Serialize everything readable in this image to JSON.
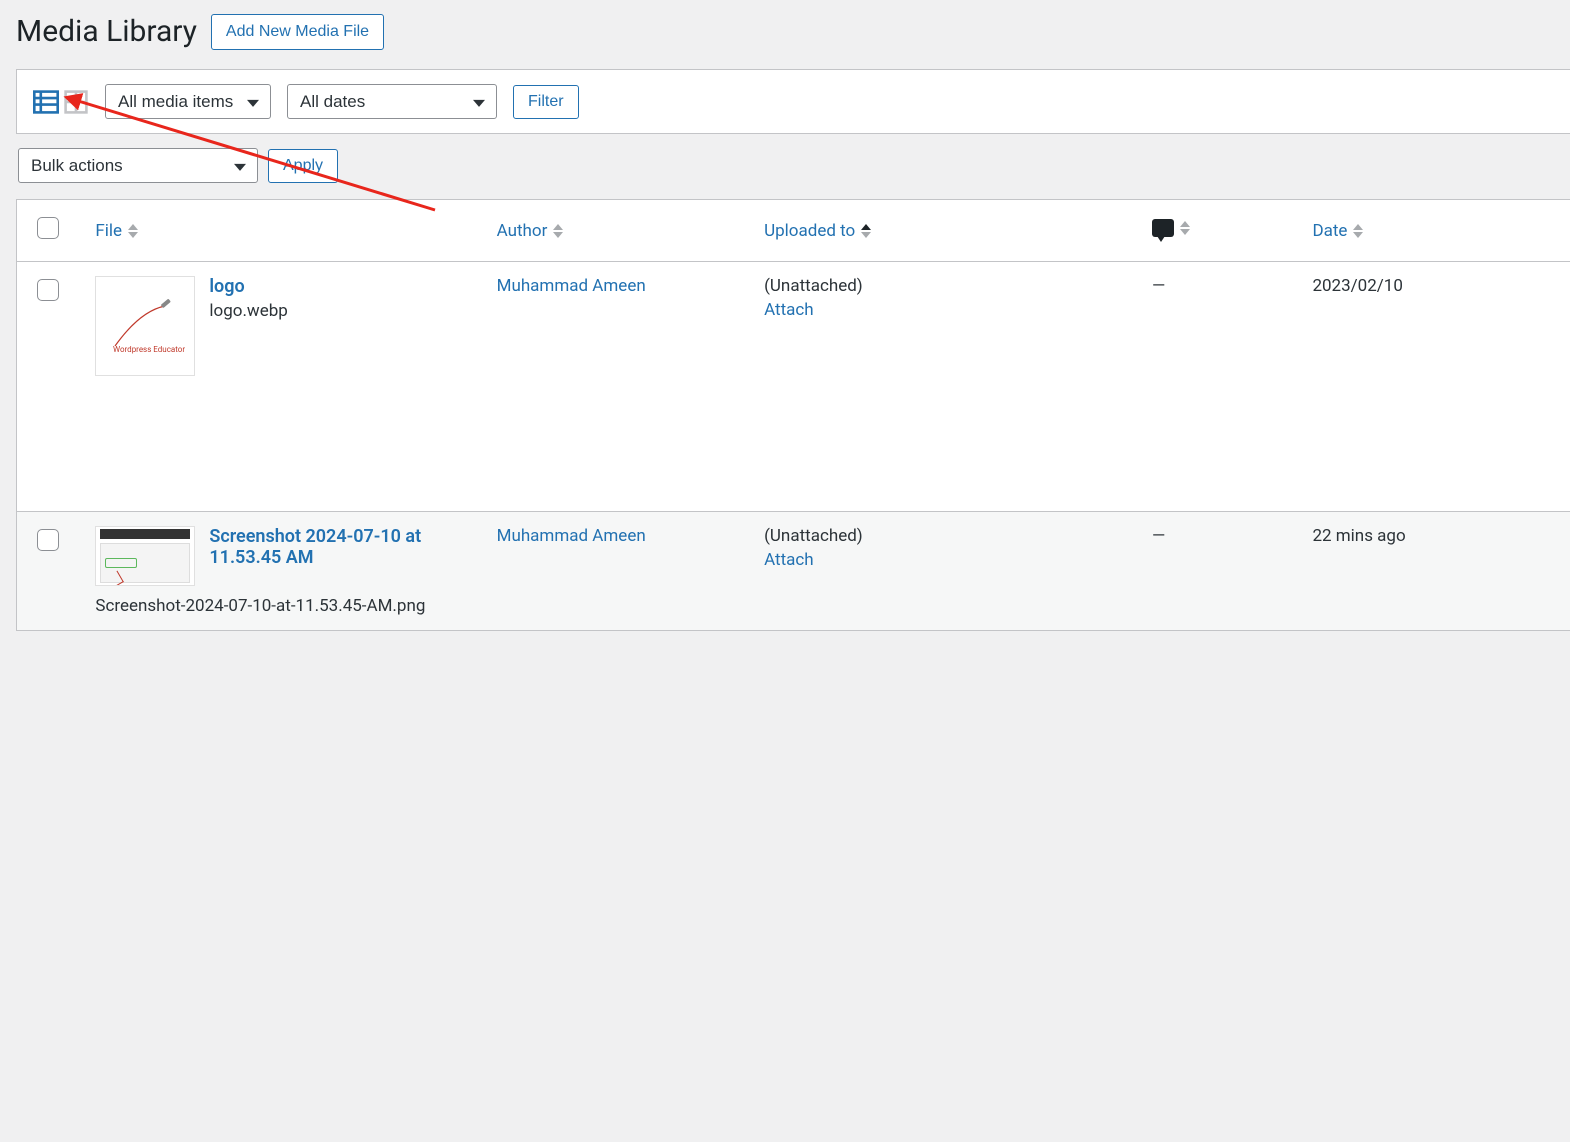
{
  "page": {
    "title": "Media Library",
    "add_button": "Add New Media File"
  },
  "filters": {
    "type_select": "All media items",
    "date_select": "All dates",
    "filter_button": "Filter"
  },
  "bulk": {
    "select_label": "Bulk actions",
    "apply_button": "Apply"
  },
  "columns": {
    "file": "File",
    "author": "Author",
    "uploaded_to": "Uploaded to",
    "date": "Date"
  },
  "rows": [
    {
      "title": "logo",
      "filename": "logo.webp",
      "author": "Muhammad Ameen",
      "uploaded_status": "(Unattached)",
      "attach_label": "Attach",
      "comments": "—",
      "date": "2023/02/10",
      "thumb_label": "Wordpress Educator"
    },
    {
      "title": "Screenshot 2024-07-10 at 11.53.45 AM",
      "filename": "Screenshot-2024-07-10-at-11.53.45-AM.png",
      "author": "Muhammad Ameen",
      "uploaded_status": "(Unattached)",
      "attach_label": "Attach",
      "comments": "—",
      "date": "22 mins ago"
    }
  ]
}
